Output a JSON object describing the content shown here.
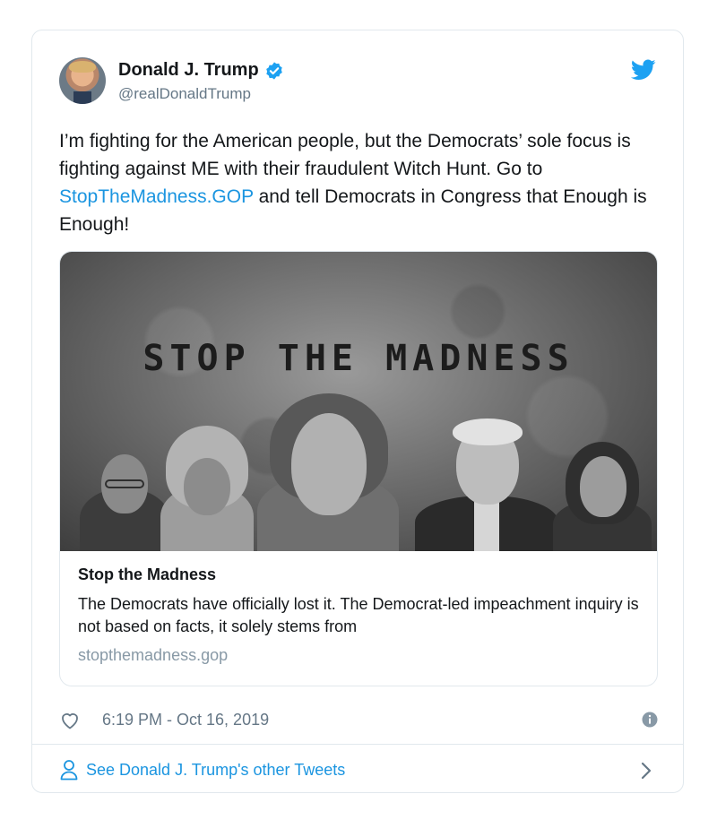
{
  "tweet": {
    "display_name": "Donald J. Trump",
    "handle": "@realDonaldTrump",
    "text_before_link": "I’m fighting for the American people, but the Democrats’ sole focus is fighting against ME with their fraudulent Witch Hunt. Go to ",
    "link_text": "StopTheMadness.GOP",
    "text_after_link": " and tell Democrats in Congress that Enough is Enough!",
    "timestamp": "6:19 PM - Oct 16, 2019"
  },
  "link_card": {
    "image_headline": "STOP THE MADNESS",
    "title": "Stop the Madness",
    "description": "The Democrats have officially lost it. The Democrat-led impeachment inquiry is not based on facts, it solely stems from",
    "domain": "stopthemadness.gop"
  },
  "footer": {
    "other_tweets_label": "See Donald J. Trump's other Tweets"
  },
  "icons": {
    "verified": "verified-badge-icon",
    "brand": "twitter-bird-icon",
    "like": "heart-icon",
    "info": "info-icon",
    "profile": "person-icon",
    "chevron": "chevron-right-icon"
  },
  "colors": {
    "accent": "#1b95e0",
    "text": "#14171a",
    "muted": "#657786",
    "border": "#e1e8ed"
  }
}
